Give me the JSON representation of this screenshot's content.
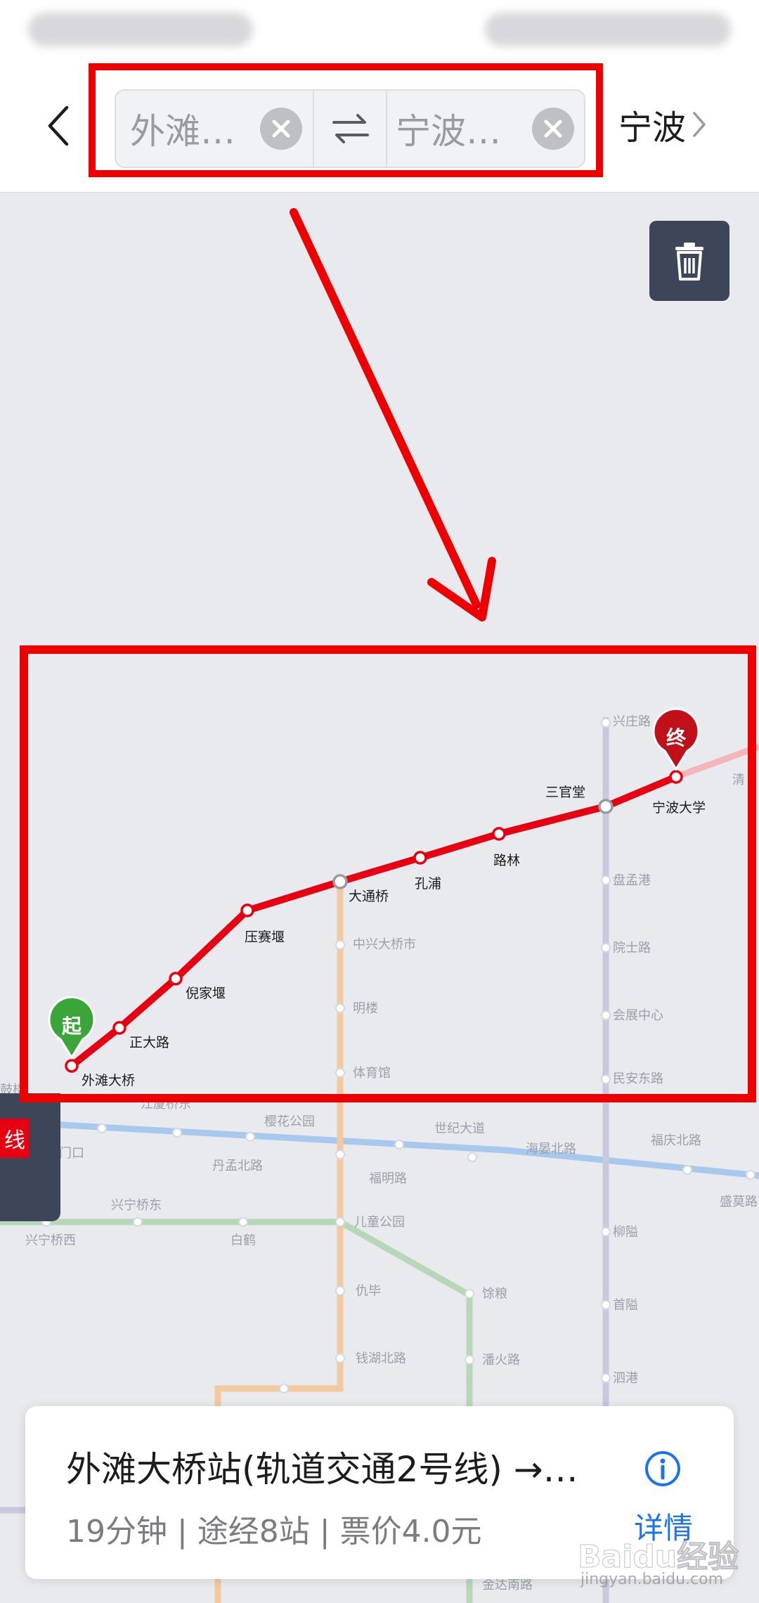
{
  "header": {
    "origin": "外滩…",
    "destination": "宁波…",
    "city": "宁波"
  },
  "map": {
    "route_line": "线",
    "route_stations": [
      {
        "name": "外滩大桥"
      },
      {
        "name": "正大路"
      },
      {
        "name": "倪家堰"
      },
      {
        "name": "压赛堰"
      },
      {
        "name": "大通桥"
      },
      {
        "name": "孔浦"
      },
      {
        "name": "路林"
      },
      {
        "name": "三官堂"
      },
      {
        "name": "宁波大学"
      }
    ],
    "start_marker": "起",
    "end_marker": "终",
    "background_stations": [
      {
        "name": "兴庄路"
      },
      {
        "name": "盘孟港"
      },
      {
        "name": "院士路"
      },
      {
        "name": "会展中心"
      },
      {
        "name": "民安东路"
      },
      {
        "name": "中兴大桥市"
      },
      {
        "name": "明楼"
      },
      {
        "name": "体育馆"
      },
      {
        "name": "樱花公园"
      },
      {
        "name": "世纪大道"
      },
      {
        "name": "海晏北路"
      },
      {
        "name": "福庆北路"
      },
      {
        "name": "盛莫路"
      },
      {
        "name": "丹孟北路"
      },
      {
        "name": "福明路"
      },
      {
        "name": "兴宁桥东"
      },
      {
        "name": "兴宁桥西"
      },
      {
        "name": "白鹤"
      },
      {
        "name": "儿童公园"
      },
      {
        "name": "柳隘"
      },
      {
        "name": "仇毕"
      },
      {
        "name": "钱湖北路"
      },
      {
        "name": "馀粮"
      },
      {
        "name": "潘火路"
      },
      {
        "name": "首隘"
      },
      {
        "name": "泗港"
      },
      {
        "name": "金达南路"
      },
      {
        "name": "清"
      },
      {
        "name": "江厦桥东"
      },
      {
        "name": "门口"
      },
      {
        "name": "鼓楼"
      }
    ]
  },
  "card": {
    "title": "外滩大桥站(轨道交通2号线) →…",
    "summary": "19分钟 | 途经8站 | 票价4.0元",
    "detail": "详情"
  },
  "watermark": {
    "brand": "Baidu经验",
    "url": "jingyan.baidu.com"
  },
  "colors": {
    "route": "#e60012",
    "line_blue": "#a9c8ee",
    "line_purple": "#c8c8de",
    "line_orange": "#f3c9a0",
    "line_green": "#b7d8b8",
    "annotation": "#ee0000",
    "start_green": "#3aa63a",
    "end_red": "#c0101a"
  }
}
